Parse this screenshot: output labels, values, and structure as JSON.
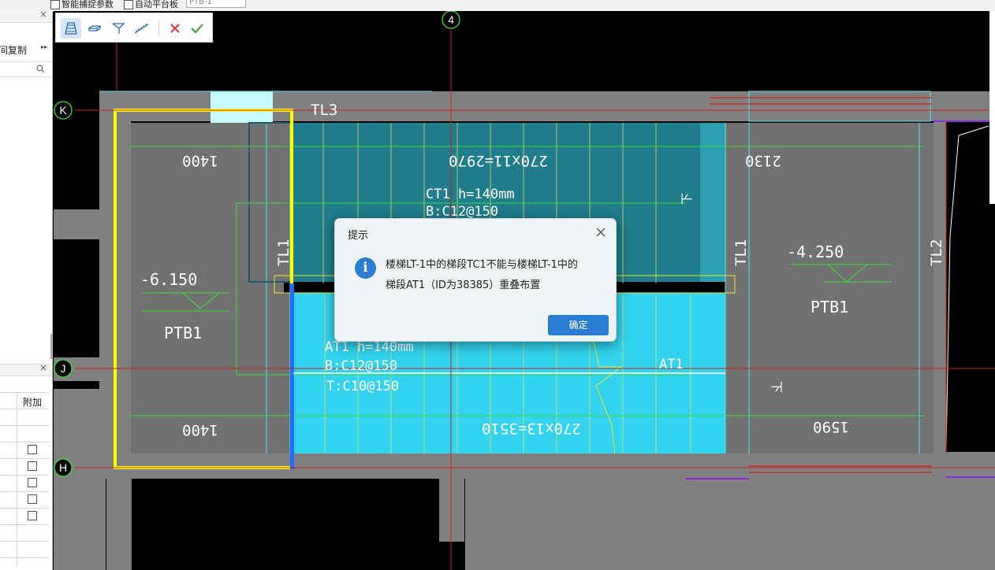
{
  "top_bar": {
    "checkbox1_label": "智能捕捉参数",
    "checkbox2_label": "自动平台板",
    "select_value": "PTB-1"
  },
  "left_panel": {
    "copy_label": "间复制",
    "expand_glyph": "▸▸",
    "search_icon": "search-icon",
    "close_glyph": "×",
    "table_header": "附加"
  },
  "toolbar": {
    "icons": [
      "stair-icon",
      "slab-icon",
      "flight-icon",
      "ramp-icon"
    ],
    "cancel_icon": "cancel-icon",
    "confirm_icon": "confirm-icon",
    "cancel_color": "#e03030",
    "confirm_color": "#3aa03a"
  },
  "drawing": {
    "axis_labels": {
      "axis_4": "4",
      "axis_K": "K",
      "axis_J": "J",
      "axis_H": "H"
    },
    "beam_TL3": "TL3",
    "beam_TL1_left": "TL1",
    "beam_TL1_right": "TL1",
    "beam_TL2": "TL2",
    "dim_1400_top": "1400",
    "dim_1400_bottom": "1400",
    "dim_2130": "2130",
    "dim_1590": "1590",
    "dim_top_run": "270x11=2970",
    "dim_bottom_run": "270x13=3510",
    "ct1_label": "CT1 h=140mm",
    "ct1_rebar": "B:C12@150",
    "at1_label": "AT1 h=140mm",
    "at1_rebar_b": "B:C12@150",
    "at1_rebar_t": "T:C10@150",
    "at1_tag": "AT1",
    "elev_left": "-6.150",
    "elev_right": "-4.250",
    "ptb1_left": "PTB1",
    "ptb1_right": "PTB1",
    "down_mark": "下",
    "colors": {
      "background": "#000000",
      "wall": "#808080",
      "stair_upper": "#1f7d8c",
      "stair_lower": "#32d3ee",
      "selection": "#ffff00",
      "axis_line": "#d02020"
    }
  },
  "dialog": {
    "title": "提示",
    "message_line1": "楼梯LT-1中的梯段TC1不能与楼梯LT-1中的",
    "message_line2": "梯段AT1（ID为38385）重叠布置",
    "ok_label": "确定",
    "info_glyph": "i",
    "close_icon": "close-icon"
  }
}
